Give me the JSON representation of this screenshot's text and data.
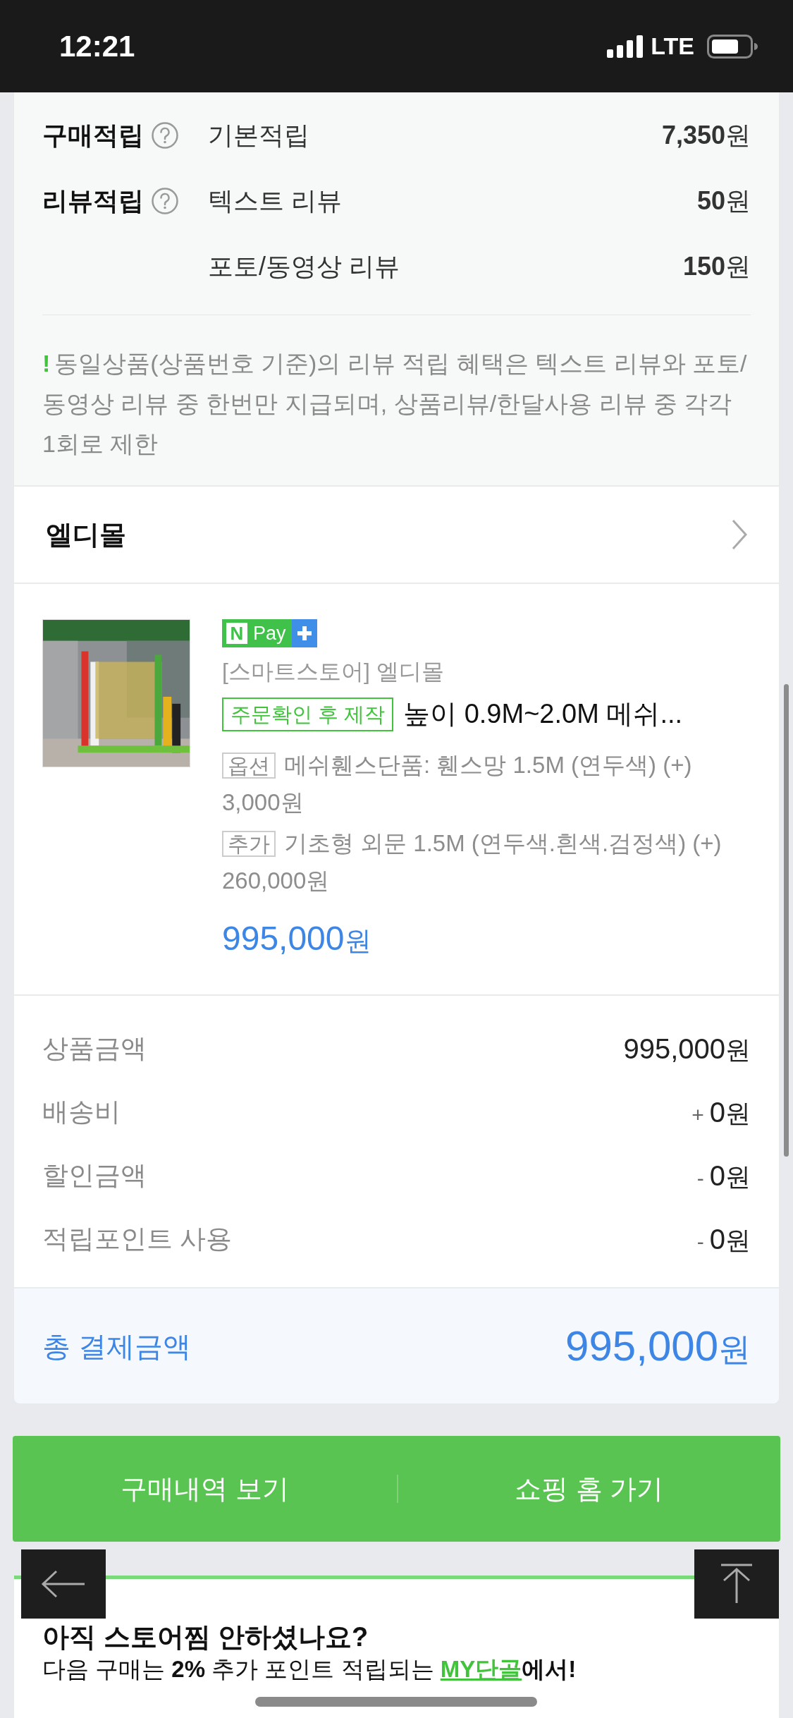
{
  "status_bar": {
    "time": "12:21",
    "network": "LTE"
  },
  "rewards": {
    "groups": [
      {
        "label": "구매적립",
        "items": [
          {
            "name": "기본적립",
            "amount": "7,350",
            "unit": "원"
          }
        ]
      },
      {
        "label": "리뷰적립",
        "items": [
          {
            "name": "텍스트 리뷰",
            "amount": "50",
            "unit": "원"
          },
          {
            "name": "포토/동영상 리뷰",
            "amount": "150",
            "unit": "원"
          }
        ]
      }
    ],
    "notice_mark": "!",
    "notice": "동일상품(상품번호 기준)의 리뷰 적립 혜택은 텍스트 리뷰와 포토/동영상 리뷰 중 한번만 지급되며, 상품리뷰/한달사용 리뷰 중 각각 1회로 제한"
  },
  "store": {
    "name": "엘디몰"
  },
  "product": {
    "badge_n": "N",
    "badge_pay": "Pay",
    "store_label": "[스마트스토어] 엘디몰",
    "tag": "주문확인 후 제작",
    "title": "높이 0.9M~2.0M 메쉬...",
    "options": [
      {
        "tag": "옵션",
        "text": "메쉬휀스단품: 휀스망 1.5M (연두색) (+) 3,000원"
      },
      {
        "tag": "추가",
        "text": "기초형 외문 1.5M (연두색.흰색.검정색) (+) 260,000원"
      }
    ],
    "price": "995,000",
    "unit": "원"
  },
  "summary": [
    {
      "label": "상품금액",
      "amount": "995,000",
      "unit": "원"
    },
    {
      "label": "배송비",
      "sign": "+",
      "amount": "0",
      "unit": "원"
    },
    {
      "label": "할인금액",
      "sign": "-",
      "amount": "0",
      "unit": "원"
    },
    {
      "label": "적립포인트 사용",
      "sign": "-",
      "amount": "0",
      "unit": "원"
    }
  ],
  "total": {
    "label": "총 결제금액",
    "amount": "995,000",
    "unit": "원"
  },
  "buttons": [
    "구매내역 보기",
    "쇼핑 홈 가기"
  ],
  "banner": {
    "title": "아직 스토어찜 안하셨나요?",
    "text": "다음 구매는 **2%** 추가 포인트 적립되는 ",
    "link": "MY단골",
    "text_end": "에서!"
  }
}
